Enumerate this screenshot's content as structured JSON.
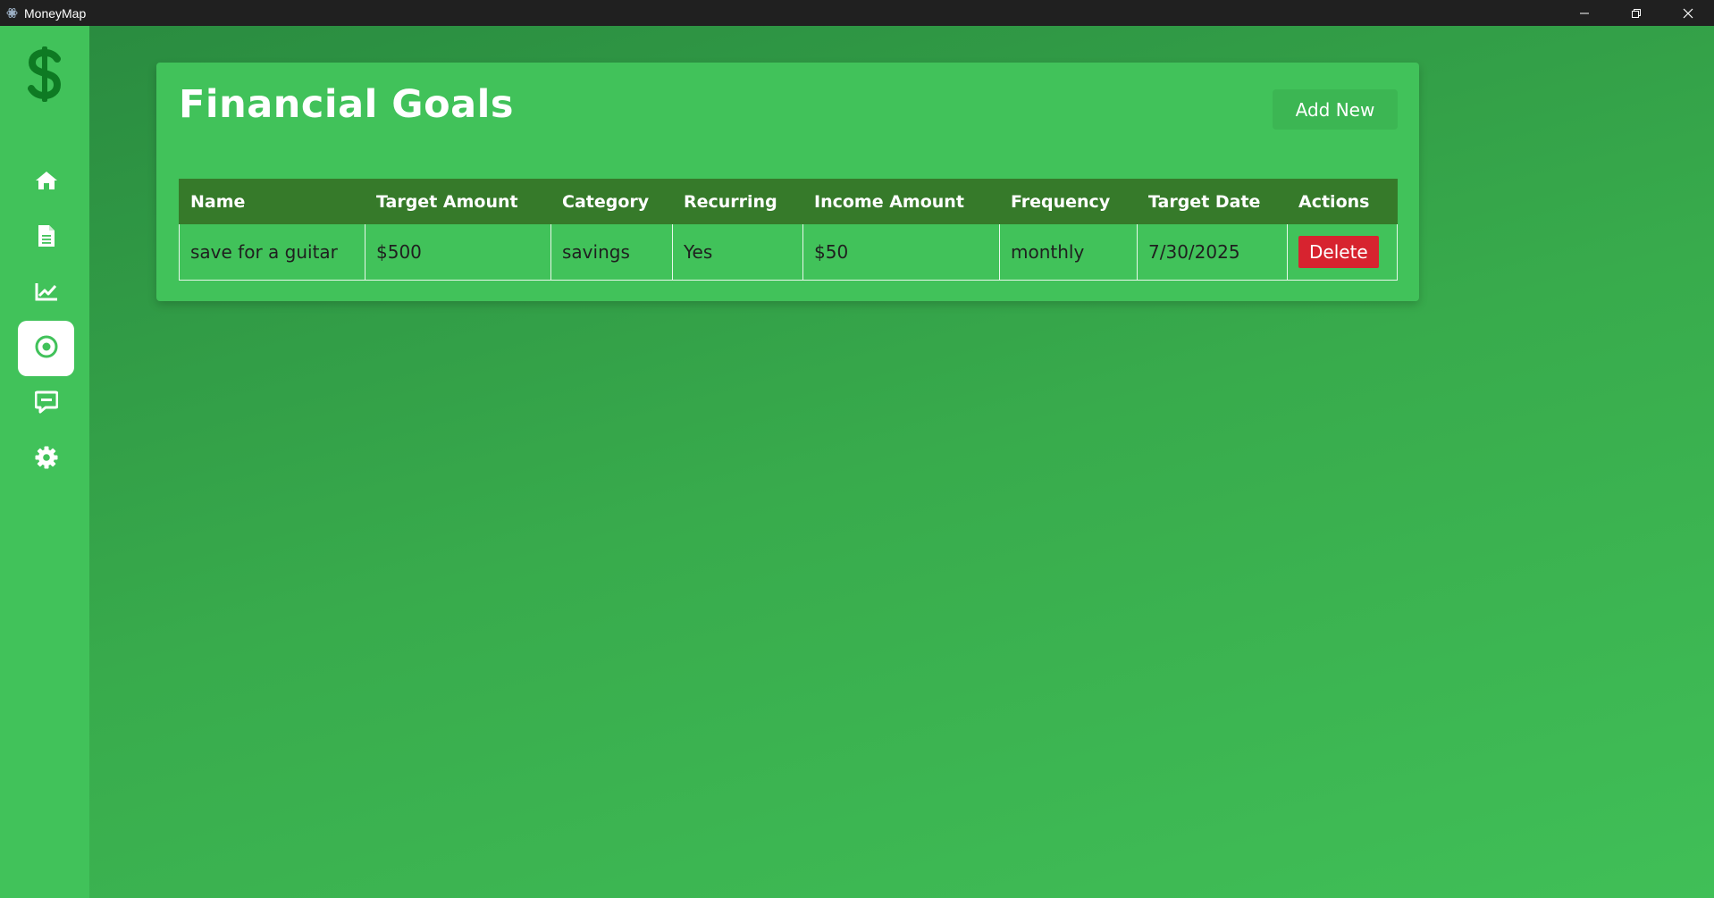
{
  "window": {
    "title": "MoneyMap",
    "controls": [
      "minimize-icon",
      "restore-icon",
      "close-icon"
    ]
  },
  "sidebar": {
    "logo": "dollar-icon",
    "items": [
      {
        "name": "home",
        "icon": "home-icon",
        "active": false
      },
      {
        "name": "documents",
        "icon": "document-icon",
        "active": false
      },
      {
        "name": "analytics",
        "icon": "chart-line-icon",
        "active": false
      },
      {
        "name": "goals",
        "icon": "target-icon",
        "active": true
      },
      {
        "name": "chat",
        "icon": "chat-icon",
        "active": false
      },
      {
        "name": "settings",
        "icon": "gear-icon",
        "active": false
      }
    ]
  },
  "main": {
    "title": "Financial Goals",
    "add_button_label": "Add New",
    "table": {
      "headers": [
        "Name",
        "Target Amount",
        "Category",
        "Recurring",
        "Income Amount",
        "Frequency",
        "Target Date",
        "Actions"
      ],
      "rows": [
        {
          "name": "save for a guitar",
          "target_amount": "$500",
          "category": "savings",
          "recurring": "Yes",
          "income_amount": "$50",
          "frequency": "monthly",
          "target_date": "7/30/2025",
          "action_label": "Delete"
        }
      ]
    }
  },
  "colors": {
    "sidebar_bg": "#41c25a",
    "card_bg": "#41c25a",
    "header_bg": "#367a2a",
    "accent_dark": "#0e7a23",
    "delete_bg": "#d7232f",
    "titlebar_bg": "#202020"
  }
}
